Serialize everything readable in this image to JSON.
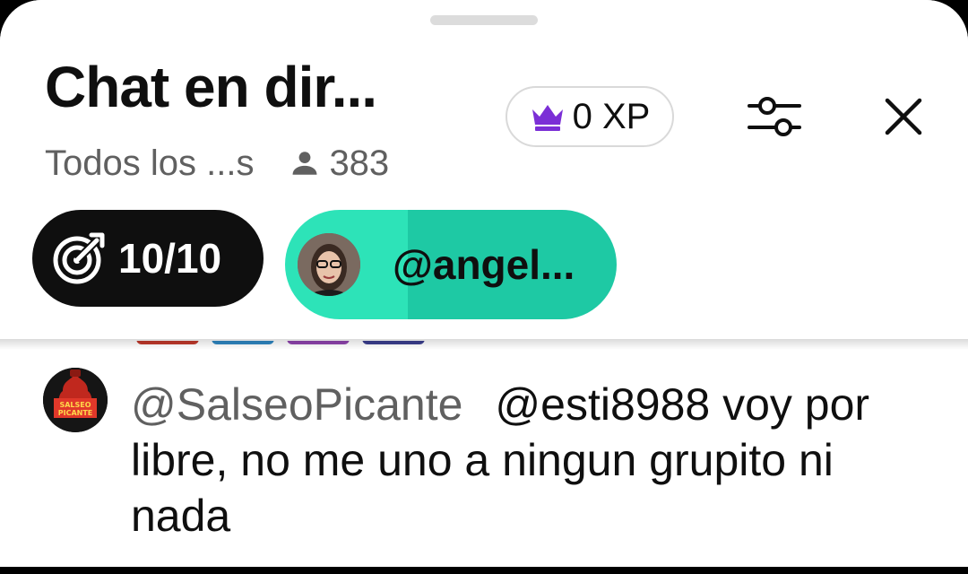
{
  "header": {
    "title": "Chat en dir...",
    "subtitle": "Todos los ...s",
    "viewer_count": "383",
    "xp_label": "0 XP",
    "goal_progress": "10/10",
    "pinned_user": "@angel..."
  },
  "message": {
    "author": "@SalseoPicante",
    "text": "@esti8988 voy por libre, no me uno a ningun grupito ni nada",
    "avatar_text_line1": "SALSEO",
    "avatar_text_line2": "PICANTE"
  },
  "icons": {
    "viewers": "person-icon",
    "xp": "crown-icon",
    "filters": "sliders-icon",
    "close": "close-icon",
    "goal": "target-arrow-icon"
  },
  "colors": {
    "crown": "#7b2fd6",
    "pill_teal_light": "#2de3b8",
    "pill_teal_dark": "#1ec9a4",
    "goal_pill": "#0f0f0f"
  }
}
